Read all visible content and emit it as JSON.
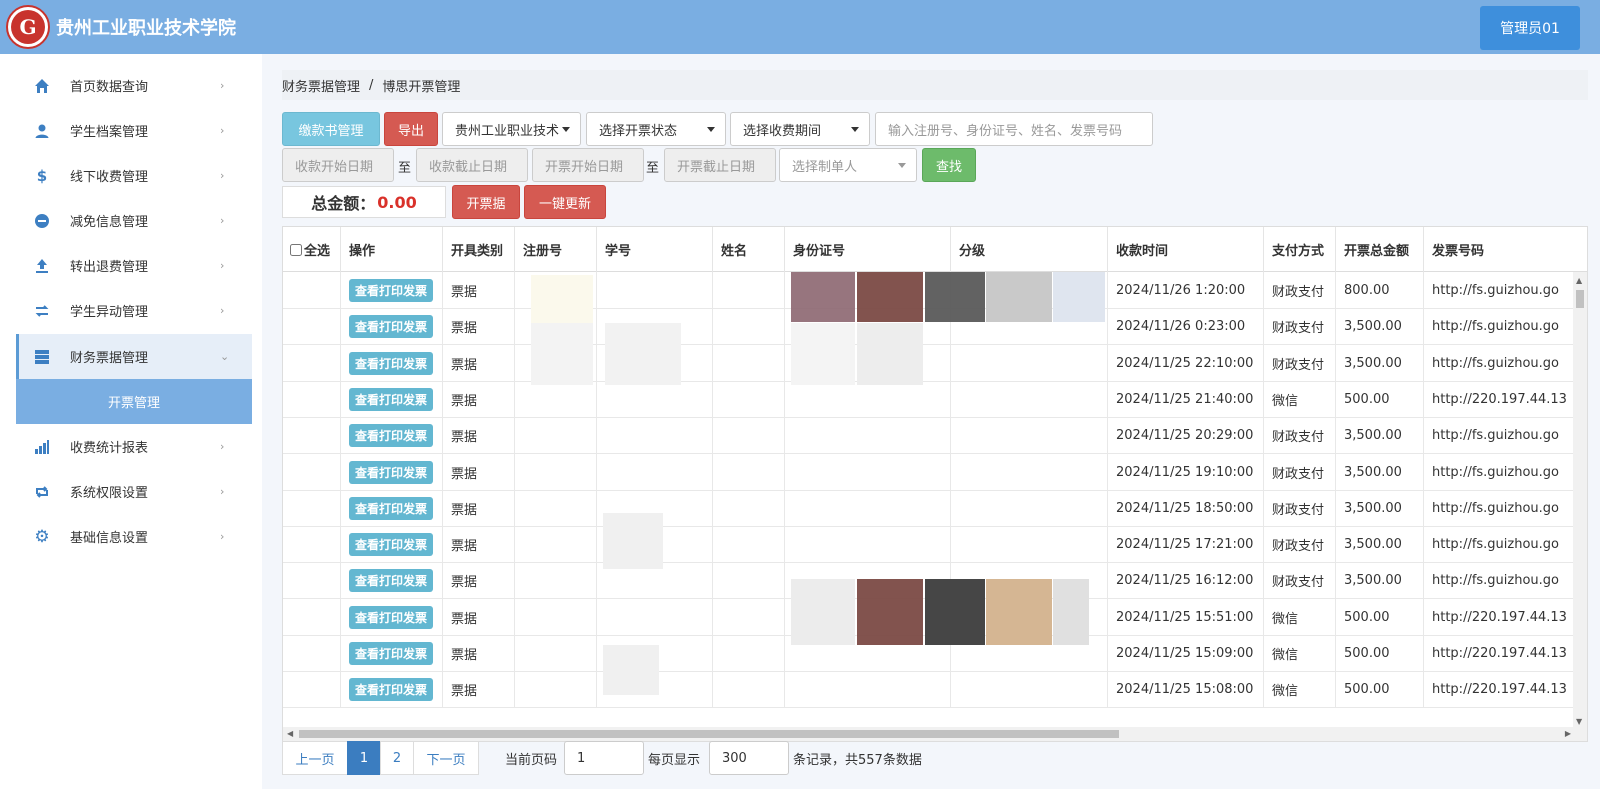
{
  "header": {
    "logo_char": "G",
    "title": "贵州工业职业技术学院",
    "admin_label": "管理员01"
  },
  "sidebar": {
    "items": [
      {
        "label": "首页数据查询",
        "icon": "home-icon"
      },
      {
        "label": "学生档案管理",
        "icon": "user-icon"
      },
      {
        "label": "线下收费管理",
        "icon": "dollar-icon"
      },
      {
        "label": "减免信息管理",
        "icon": "minus-circle-icon"
      },
      {
        "label": "转出退费管理",
        "icon": "upload-icon"
      },
      {
        "label": "学生异动管理",
        "icon": "exchange-icon"
      },
      {
        "label": "财务票据管理",
        "icon": "server-icon"
      },
      {
        "label": "收费统计报表",
        "icon": "bar-chart-icon"
      },
      {
        "label": "系统权限设置",
        "icon": "retweet-icon"
      },
      {
        "label": "基础信息设置",
        "icon": "gear-icon"
      }
    ],
    "sub_item": "开票管理"
  },
  "breadcrumb": {
    "parent": "财务票据管理",
    "separator": "/",
    "current": "博思开票管理"
  },
  "toolbar": {
    "payment_btn": "缴款书管理",
    "export_btn": "导出",
    "school_select": "贵州工业职业技术",
    "status_select": "选择开票状态",
    "period_select": "选择收费期间",
    "search_placeholder": "输入注册号、身份证号、姓名、发票号码",
    "pay_start_placeholder": "收款开始日期",
    "to1": "至",
    "pay_end_placeholder": "收款截止日期",
    "inv_start_placeholder": "开票开始日期",
    "to2": "至",
    "inv_end_placeholder": "开票截止日期",
    "maker_select": "选择制单人",
    "search_btn": "查找",
    "total_label": "总金额：",
    "total_value": "0.00",
    "issue_btn": "开票据",
    "update_btn": "一键更新"
  },
  "table": {
    "headers": [
      "全选",
      "操作",
      "开具类别",
      "注册号",
      "学号",
      "姓名",
      "身份证号",
      "分级",
      "收款时间",
      "支付方式",
      "开票总金额",
      "发票号码"
    ],
    "action_label": "查看打印发票",
    "rows": [
      {
        "type": "票据",
        "time": "2024/11/26 1:20:00",
        "pay": "财政支付",
        "amount": "800.00",
        "invoice": "http://fs.guizhou.go"
      },
      {
        "type": "票据",
        "time": "2024/11/26 0:23:00",
        "pay": "财政支付",
        "amount": "3,500.00",
        "invoice": "http://fs.guizhou.go"
      },
      {
        "type": "票据",
        "time": "2024/11/25 22:10:00",
        "pay": "财政支付",
        "amount": "3,500.00",
        "invoice": "http://fs.guizhou.go"
      },
      {
        "type": "票据",
        "time": "2024/11/25 21:40:00",
        "pay": "微信",
        "amount": "500.00",
        "invoice": "http://220.197.44.13"
      },
      {
        "type": "票据",
        "time": "2024/11/25 20:29:00",
        "pay": "财政支付",
        "amount": "3,500.00",
        "invoice": "http://fs.guizhou.go"
      },
      {
        "type": "票据",
        "time": "2024/11/25 19:10:00",
        "pay": "财政支付",
        "amount": "3,500.00",
        "invoice": "http://fs.guizhou.go"
      },
      {
        "type": "票据",
        "time": "2024/11/25 18:50:00",
        "pay": "财政支付",
        "amount": "3,500.00",
        "invoice": "http://fs.guizhou.go"
      },
      {
        "type": "票据",
        "time": "2024/11/25 17:21:00",
        "pay": "财政支付",
        "amount": "3,500.00",
        "invoice": "http://fs.guizhou.go"
      },
      {
        "type": "票据",
        "time": "2024/11/25 16:12:00",
        "pay": "财政支付",
        "amount": "3,500.00",
        "invoice": "http://fs.guizhou.go"
      },
      {
        "type": "票据",
        "time": "2024/11/25 15:51:00",
        "pay": "微信",
        "amount": "500.00",
        "invoice": "http://220.197.44.13"
      },
      {
        "type": "票据",
        "time": "2024/11/25 15:09:00",
        "pay": "微信",
        "amount": "500.00",
        "invoice": "http://220.197.44.13"
      },
      {
        "type": "票据",
        "time": "2024/11/25 15:08:00",
        "pay": "微信",
        "amount": "500.00",
        "invoice": "http://220.197.44.13"
      }
    ]
  },
  "pagination": {
    "prev": "上一页",
    "pages": [
      "1",
      "2"
    ],
    "active_page": "1",
    "next": "下一页",
    "current_label": "当前页码",
    "current_value": "1",
    "per_page_label": "每页显示",
    "per_page_value": "300",
    "summary": "条记录，共557条数据"
  },
  "colors": {
    "header_bg": "#7aaee2",
    "admin_btn": "#3e8fdc",
    "info_btn": "#78c6df",
    "danger_btn": "#d55a52",
    "success_btn": "#6dbb6b",
    "total_amount": "#d9312a",
    "active_page": "#3b7dc0"
  }
}
